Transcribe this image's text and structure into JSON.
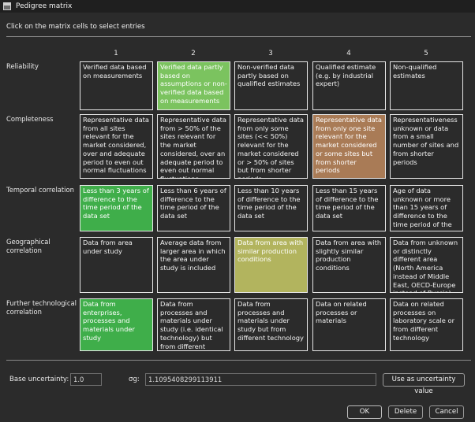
{
  "window": {
    "title": "Pedigree matrix"
  },
  "instruction": "Click on the matrix cells to select entries",
  "columns": [
    "1",
    "2",
    "3",
    "4",
    "5"
  ],
  "rows": [
    {
      "label": "Reliability",
      "cells": [
        "Verified data based on measurements",
        "Verified data partly based on assumptions or non-verified data based on measurements",
        "Non-verified data partly based on qualified estimates",
        "Qualified estimate (e.g. by industrial expert)",
        "Non-qualified estimates"
      ],
      "selected": 2,
      "selected_color": "#7bc35f"
    },
    {
      "label": "Completeness",
      "cells": [
        "Representative data from all sites relevant for the market considered, over and adequate period to even out normal fluctuations",
        "Representative data from > 50% of the sites relevant for the market considered, over an adequate period to even out normal fluctuations",
        "Representative data from only some sites (<< 50%) relevant for the market considered or > 50% of sites but from shorter periods",
        "Representative data from only one site relevant for the market considered or some sites but from shorter periods",
        "Representativeness unknown or data from a small number of sites and from shorter periods"
      ],
      "selected": 4,
      "selected_color": "#a97b56"
    },
    {
      "label": "Temporal correlation",
      "cells": [
        "Less than 3 years of difference to the time period of the data set",
        "Less than 6 years of difference to the time period of the data set",
        "Less than 10 years of difference to the time period of the data set",
        "Less than 15 years of difference to the time period of the data set",
        "Age of data unknown or more than 15 years of difference to the time period of the data set"
      ],
      "selected": 1,
      "selected_color": "#3fae4a"
    },
    {
      "label": "Geographical correlation",
      "cells": [
        "Data from area under study",
        "Average data from larger area in which the area under study is included",
        "Data from area with similar production conditions",
        "Data from area with slightly similar production conditions",
        "Data from unknown or distinctly different area (North America instead of Middle East, OECD-Europe instead of Russia)"
      ],
      "selected": 3,
      "selected_color": "#b2b45e"
    },
    {
      "label": "Further technological correlation",
      "cells": [
        "Data from enterprises, processes and materials under study",
        "Data from processes and materials under study (i.e. identical technology) but from different enterprises",
        "Data from processes and materials under study but from different technology",
        "Data on related processes or materials",
        "Data on related processes on laboratory scale or from different technology"
      ],
      "selected": 1,
      "selected_color": "#3fae4a"
    }
  ],
  "footer": {
    "base_uncertainty_label": "Base uncertainty:",
    "base_uncertainty_value": "1.0",
    "sigma_label": "σg:",
    "sigma_value": "1.1095408299113911",
    "use_button": "Use as uncertainty value"
  },
  "buttons": {
    "ok": "OK",
    "delete": "Delete",
    "cancel": "Cancel"
  }
}
